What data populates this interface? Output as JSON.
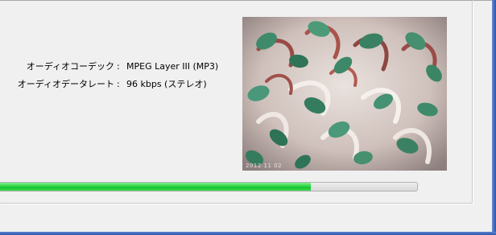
{
  "media_info": {
    "audio_codec": {
      "label": "オーディオコーデック",
      "separator": ":",
      "value": "MPEG Layer III (MP3)"
    },
    "audio_bitrate": {
      "label": "オーディオデータレート",
      "separator": ":",
      "value": "96 kbps (ステレオ)"
    }
  },
  "preview": {
    "icon": "video-thumbnail",
    "timestamp": "2012 11 02"
  },
  "progress": {
    "fraction": 0.745,
    "fill_color": "#22c83a"
  }
}
